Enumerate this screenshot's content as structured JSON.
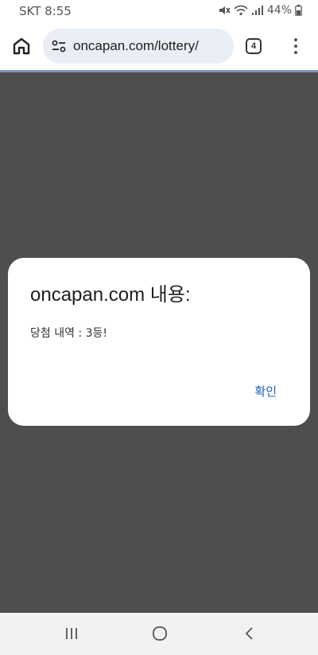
{
  "status_bar": {
    "carrier_time": "SKT 8:55",
    "battery": "44%"
  },
  "browser": {
    "url": "oncapan.com/lottery/",
    "tab_count": "4"
  },
  "dialog": {
    "title": "oncapan.com 내용:",
    "message": "당첨 내역 : 3등!",
    "ok_label": "확인"
  },
  "icons": {
    "home": "home-icon",
    "site_info": "tune-icon",
    "menu": "more-vert-icon",
    "recents": "recents-icon",
    "nav_home": "circle-home-icon",
    "back": "back-icon"
  },
  "colors": {
    "overlay": "#4e4e4e",
    "url_bar": "#e9edf4",
    "accent": "#1a5fb4"
  }
}
